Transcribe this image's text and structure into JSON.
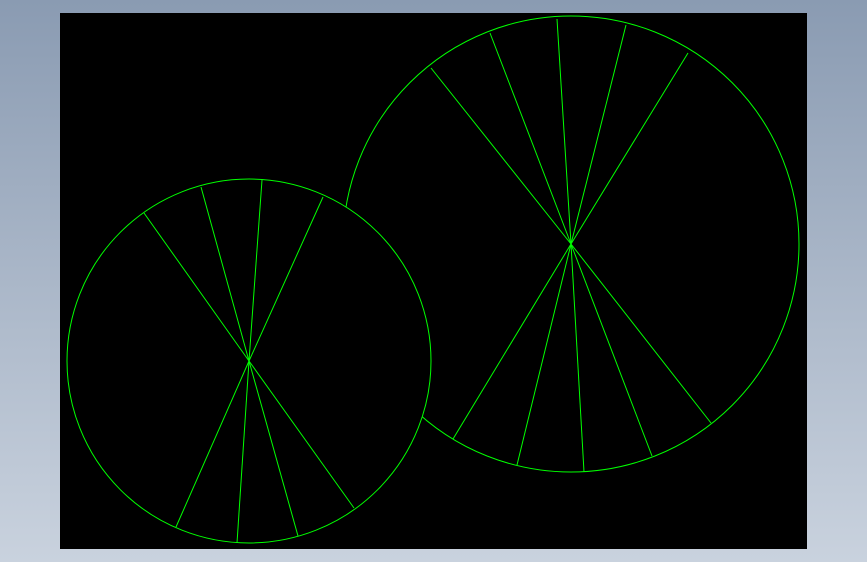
{
  "viewport": {
    "background_color": "#000000",
    "line_color": "#00ff00",
    "surround_color": "#9aa8bc"
  },
  "figures": [
    {
      "name": "small-wheel",
      "description_shape": "circle with radial spokes from center",
      "spoke_count": 8
    },
    {
      "name": "large-wheel",
      "description_shape": "circle with radial spokes from center",
      "spoke_count": 10
    }
  ]
}
